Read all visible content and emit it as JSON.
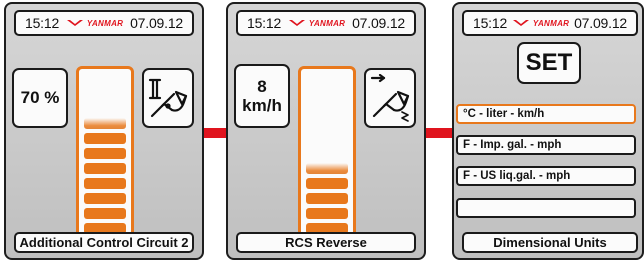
{
  "colors": {
    "accent": "#e8781c",
    "brand": "#e0141e",
    "frame": "#1a1a1a"
  },
  "panels": [
    {
      "time": "15:12",
      "brand": "YANMAR",
      "date": "07.09.12",
      "value": "70 %",
      "icon": "additional-circuit-2-icon",
      "level": 0.7,
      "label": "Additional Control Circuit 2"
    },
    {
      "time": "15:12",
      "brand": "YANMAR",
      "date": "07.09.12",
      "value_line1": "8",
      "value_line2": "km/h",
      "icon": "rcs-reverse-icon",
      "level": 0.4,
      "label": "RCS Reverse"
    },
    {
      "time": "15:12",
      "brand": "YANMAR",
      "date": "07.09.12",
      "set_label": "SET",
      "options": [
        "°C - liter - km/h",
        "F - Imp. gal. - mph",
        "F - US liq.gal. - mph",
        ""
      ],
      "selected_option": 0,
      "label": "Dimensional Units"
    }
  ]
}
